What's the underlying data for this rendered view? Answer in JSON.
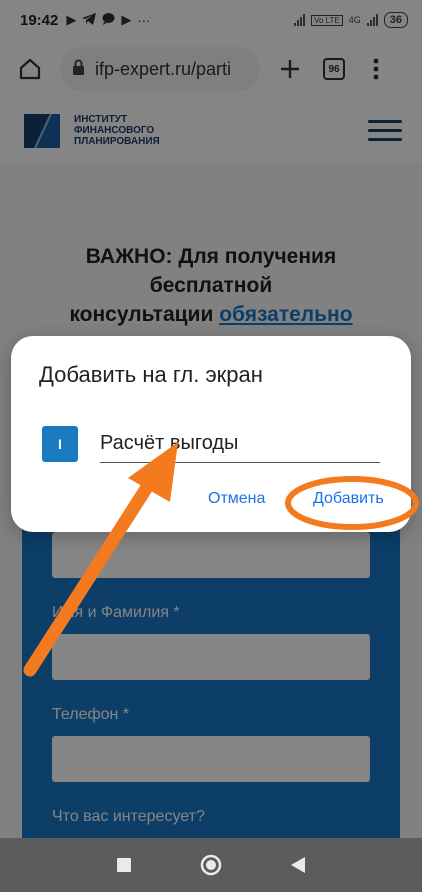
{
  "status_bar": {
    "time": "19:42",
    "icons": [
      "play-icon",
      "telegram-icon",
      "chat-icon",
      "play-icon",
      "more-icon"
    ],
    "network": "4G",
    "battery": "36"
  },
  "browser": {
    "url": "ifp-expert.ru/parti",
    "tabs_count": "96"
  },
  "site": {
    "logo_lines": [
      "ИНСТИТУТ",
      "ФИНАНСОВОГО",
      "ПЛАНИРОВАНИЯ"
    ],
    "hero_line1": "ВАЖНО: Для получения",
    "hero_line2": "бесплатной",
    "hero_line3_prefix": "консультации ",
    "hero_line3_link": "обязательно",
    "form": {
      "name_label": "Имя и Фамилия *",
      "phone_label": "Телефон *",
      "interest_label": "Что вас интересует?"
    }
  },
  "dialog": {
    "title": "Добавить на гл. экран",
    "app_icon_letter": "I",
    "shortcut_name": "Расчёт выгоды",
    "cancel_label": "Отмена",
    "add_label": "Добавить"
  },
  "colors": {
    "accent": "#1a73e8",
    "form_blue": "#1878c8",
    "annotation_orange": "#f47a20"
  }
}
